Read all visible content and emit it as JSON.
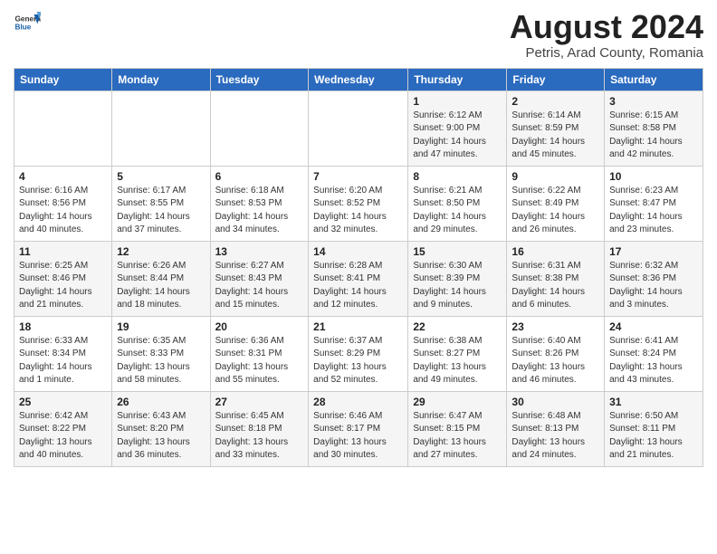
{
  "header": {
    "logo_general": "General",
    "logo_blue": "Blue",
    "month_title": "August 2024",
    "location": "Petris, Arad County, Romania"
  },
  "weekdays": [
    "Sunday",
    "Monday",
    "Tuesday",
    "Wednesday",
    "Thursday",
    "Friday",
    "Saturday"
  ],
  "weeks": [
    [
      {
        "day": "",
        "info": ""
      },
      {
        "day": "",
        "info": ""
      },
      {
        "day": "",
        "info": ""
      },
      {
        "day": "",
        "info": ""
      },
      {
        "day": "1",
        "info": "Sunrise: 6:12 AM\nSunset: 9:00 PM\nDaylight: 14 hours and 47 minutes."
      },
      {
        "day": "2",
        "info": "Sunrise: 6:14 AM\nSunset: 8:59 PM\nDaylight: 14 hours and 45 minutes."
      },
      {
        "day": "3",
        "info": "Sunrise: 6:15 AM\nSunset: 8:58 PM\nDaylight: 14 hours and 42 minutes."
      }
    ],
    [
      {
        "day": "4",
        "info": "Sunrise: 6:16 AM\nSunset: 8:56 PM\nDaylight: 14 hours and 40 minutes."
      },
      {
        "day": "5",
        "info": "Sunrise: 6:17 AM\nSunset: 8:55 PM\nDaylight: 14 hours and 37 minutes."
      },
      {
        "day": "6",
        "info": "Sunrise: 6:18 AM\nSunset: 8:53 PM\nDaylight: 14 hours and 34 minutes."
      },
      {
        "day": "7",
        "info": "Sunrise: 6:20 AM\nSunset: 8:52 PM\nDaylight: 14 hours and 32 minutes."
      },
      {
        "day": "8",
        "info": "Sunrise: 6:21 AM\nSunset: 8:50 PM\nDaylight: 14 hours and 29 minutes."
      },
      {
        "day": "9",
        "info": "Sunrise: 6:22 AM\nSunset: 8:49 PM\nDaylight: 14 hours and 26 minutes."
      },
      {
        "day": "10",
        "info": "Sunrise: 6:23 AM\nSunset: 8:47 PM\nDaylight: 14 hours and 23 minutes."
      }
    ],
    [
      {
        "day": "11",
        "info": "Sunrise: 6:25 AM\nSunset: 8:46 PM\nDaylight: 14 hours and 21 minutes."
      },
      {
        "day": "12",
        "info": "Sunrise: 6:26 AM\nSunset: 8:44 PM\nDaylight: 14 hours and 18 minutes."
      },
      {
        "day": "13",
        "info": "Sunrise: 6:27 AM\nSunset: 8:43 PM\nDaylight: 14 hours and 15 minutes."
      },
      {
        "day": "14",
        "info": "Sunrise: 6:28 AM\nSunset: 8:41 PM\nDaylight: 14 hours and 12 minutes."
      },
      {
        "day": "15",
        "info": "Sunrise: 6:30 AM\nSunset: 8:39 PM\nDaylight: 14 hours and 9 minutes."
      },
      {
        "day": "16",
        "info": "Sunrise: 6:31 AM\nSunset: 8:38 PM\nDaylight: 14 hours and 6 minutes."
      },
      {
        "day": "17",
        "info": "Sunrise: 6:32 AM\nSunset: 8:36 PM\nDaylight: 14 hours and 3 minutes."
      }
    ],
    [
      {
        "day": "18",
        "info": "Sunrise: 6:33 AM\nSunset: 8:34 PM\nDaylight: 14 hours and 1 minute."
      },
      {
        "day": "19",
        "info": "Sunrise: 6:35 AM\nSunset: 8:33 PM\nDaylight: 13 hours and 58 minutes."
      },
      {
        "day": "20",
        "info": "Sunrise: 6:36 AM\nSunset: 8:31 PM\nDaylight: 13 hours and 55 minutes."
      },
      {
        "day": "21",
        "info": "Sunrise: 6:37 AM\nSunset: 8:29 PM\nDaylight: 13 hours and 52 minutes."
      },
      {
        "day": "22",
        "info": "Sunrise: 6:38 AM\nSunset: 8:27 PM\nDaylight: 13 hours and 49 minutes."
      },
      {
        "day": "23",
        "info": "Sunrise: 6:40 AM\nSunset: 8:26 PM\nDaylight: 13 hours and 46 minutes."
      },
      {
        "day": "24",
        "info": "Sunrise: 6:41 AM\nSunset: 8:24 PM\nDaylight: 13 hours and 43 minutes."
      }
    ],
    [
      {
        "day": "25",
        "info": "Sunrise: 6:42 AM\nSunset: 8:22 PM\nDaylight: 13 hours and 40 minutes."
      },
      {
        "day": "26",
        "info": "Sunrise: 6:43 AM\nSunset: 8:20 PM\nDaylight: 13 hours and 36 minutes."
      },
      {
        "day": "27",
        "info": "Sunrise: 6:45 AM\nSunset: 8:18 PM\nDaylight: 13 hours and 33 minutes."
      },
      {
        "day": "28",
        "info": "Sunrise: 6:46 AM\nSunset: 8:17 PM\nDaylight: 13 hours and 30 minutes."
      },
      {
        "day": "29",
        "info": "Sunrise: 6:47 AM\nSunset: 8:15 PM\nDaylight: 13 hours and 27 minutes."
      },
      {
        "day": "30",
        "info": "Sunrise: 6:48 AM\nSunset: 8:13 PM\nDaylight: 13 hours and 24 minutes."
      },
      {
        "day": "31",
        "info": "Sunrise: 6:50 AM\nSunset: 8:11 PM\nDaylight: 13 hours and 21 minutes."
      }
    ]
  ]
}
